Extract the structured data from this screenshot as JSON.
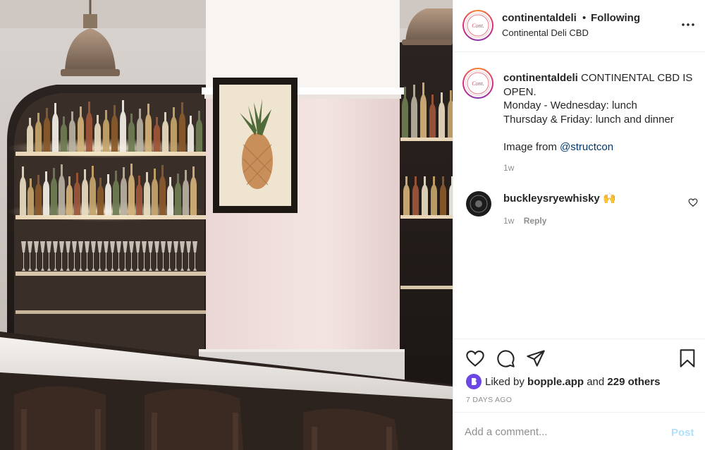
{
  "post": {
    "photo_alt": "",
    "author": {
      "username": "continentaldeli",
      "follow_status": "Following",
      "follow_separator": "•",
      "location": "Continental Deli CBD",
      "logo_text": "Continental"
    },
    "caption": {
      "username": "continentaldeli",
      "line1": "CONTINENTAL CBD IS OPEN.",
      "line2": "Monday - Wednesday: lunch",
      "line3": "Thursday & Friday: lunch and dinner",
      "image_credit_prefix": "Image from ",
      "mention": "@structcon",
      "time": "1w"
    },
    "comments": [
      {
        "username": "buckleysryewhisky",
        "text": "🙌",
        "time": "1w",
        "reply_label": "Reply"
      }
    ],
    "likes": {
      "prefix": "Liked by",
      "liker": "bopple.app",
      "conjunction": "and",
      "others": "229 others"
    },
    "date": "7 DAYS AGO",
    "add_comment": {
      "placeholder": "Add a comment...",
      "post_label": "Post"
    }
  },
  "icons": {
    "more": "more-options-icon",
    "like": "heart-icon",
    "comment": "comment-icon",
    "share": "paper-plane-icon",
    "save": "bookmark-icon",
    "comment_like": "small-heart-icon"
  },
  "colors": {
    "text": "#262626",
    "secondary": "#8e8e8e",
    "link": "#00376b",
    "post_disabled": "#b2dffc",
    "border": "#efefef"
  }
}
